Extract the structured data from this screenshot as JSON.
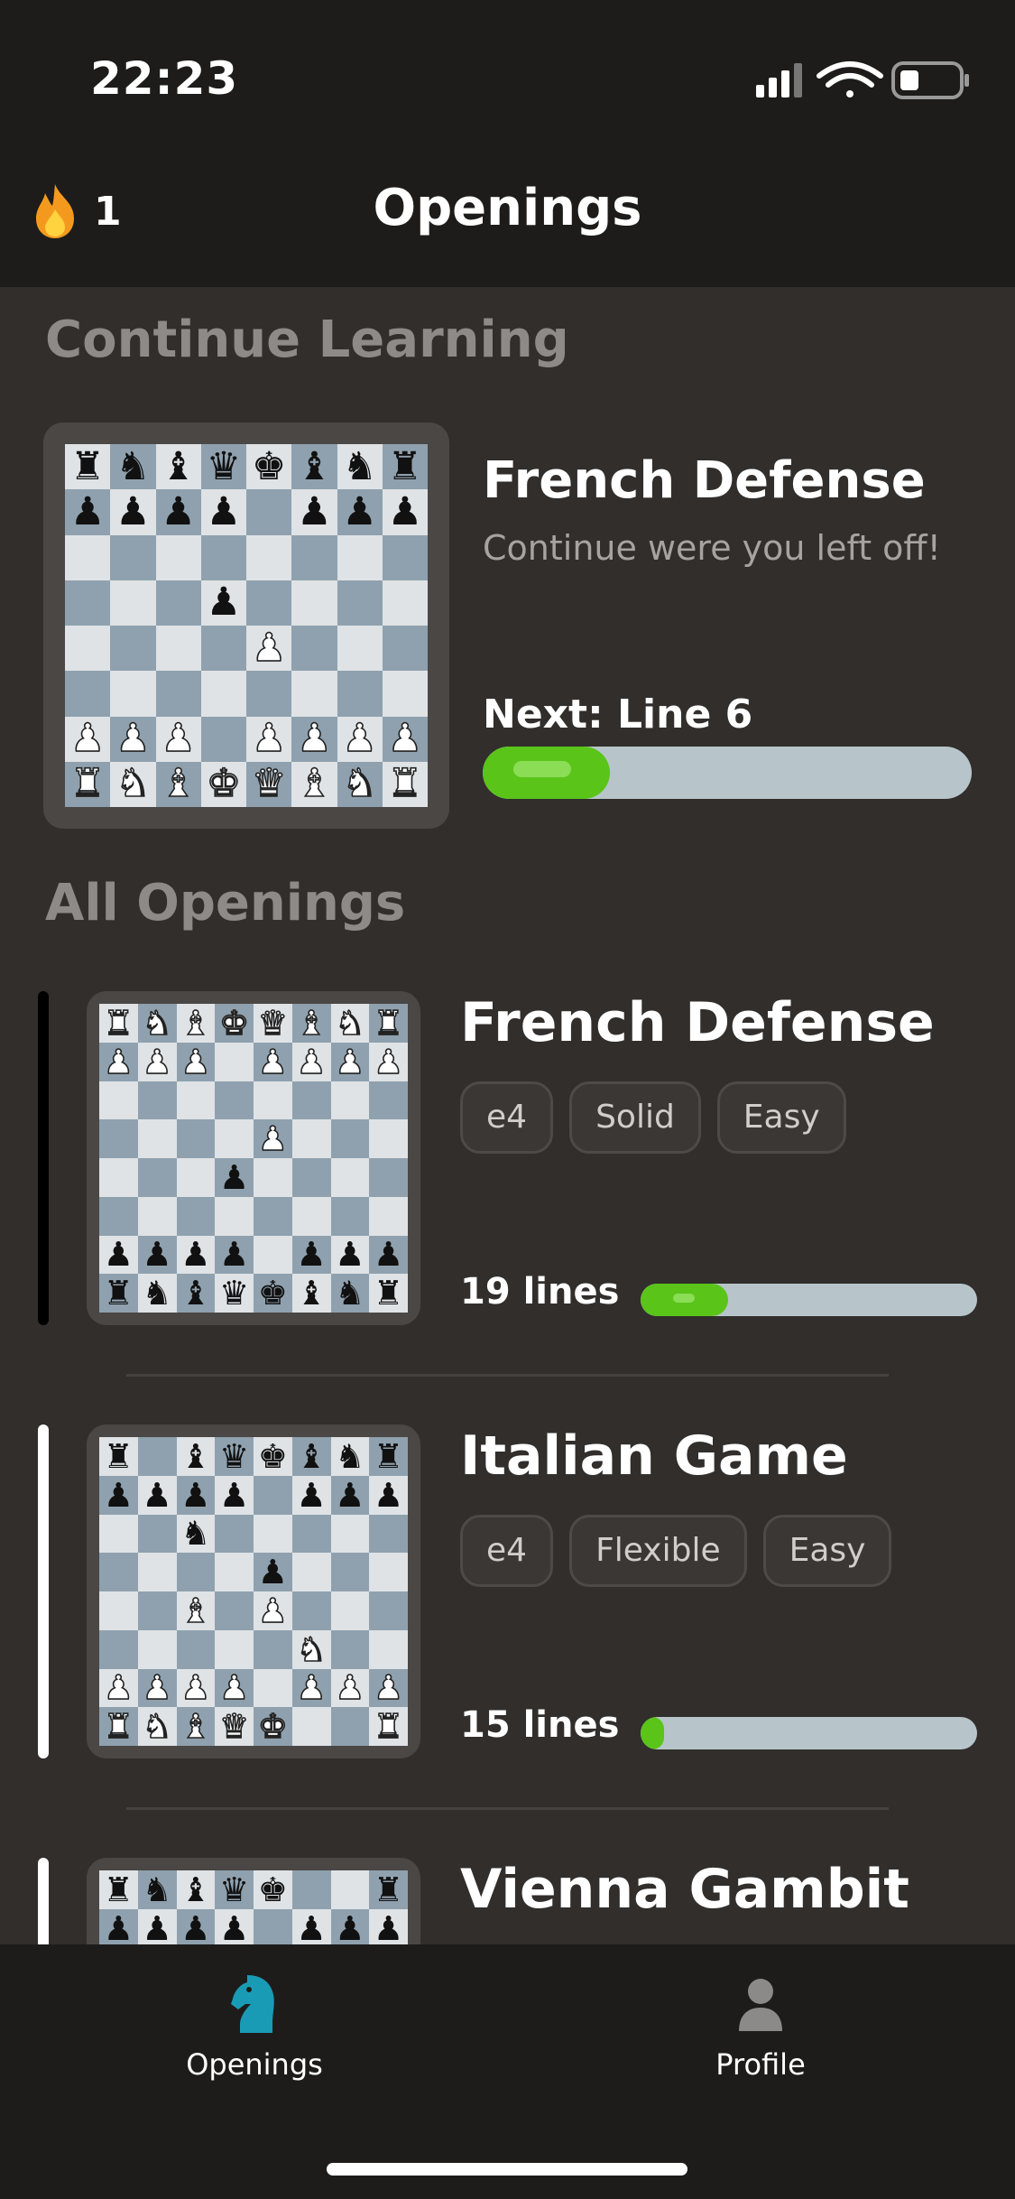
{
  "status": {
    "time": "22:23"
  },
  "header": {
    "title": "Openings",
    "streak_count": "1",
    "streak_icon": "fire-icon"
  },
  "continue": {
    "section_title": "Continue Learning",
    "title": "French Defense",
    "subtitle": "Continue were you left off!",
    "next_label": "Next: Line 6",
    "progress": 0.26,
    "board": [
      "rnbqkbnr",
      "pppp.ppp",
      "........",
      "...p....",
      "....P...",
      "........",
      "PPP.PPPP",
      "RNBKQBNR"
    ]
  },
  "all_openings": {
    "section_title": "All Openings",
    "items": [
      {
        "title": "French Defense",
        "tags": [
          "e4",
          "Solid",
          "Easy"
        ],
        "lines": "19 lines",
        "progress": 0.26,
        "selected": true,
        "board": [
          "RNBKQBNR",
          "PPP.PPPP",
          "........",
          "....P...",
          "...p....",
          "........",
          "pppp.ppp",
          "rnbqkbnr"
        ]
      },
      {
        "title": "Italian Game",
        "tags": [
          "e4",
          "Flexible",
          "Easy"
        ],
        "lines": "15 lines",
        "progress": 0.07,
        "selected": false,
        "board": [
          "r.bqkbnr",
          "pppp.ppp",
          "..n.....",
          "....p...",
          "..B.P...",
          ".....N..",
          "PPPP.PPP",
          "RNBQK..R"
        ]
      },
      {
        "title": "Vienna Gambit",
        "tags": [],
        "lines": "",
        "progress": 0,
        "selected": false,
        "board": [
          "rnbqk..r",
          "pppp.ppp",
          "........",
          "........",
          "........",
          "........",
          "........",
          "........"
        ]
      }
    ]
  },
  "tabs": [
    {
      "label": "Openings",
      "icon": "knight-icon",
      "active": true,
      "color": "#1a9bb5"
    },
    {
      "label": "Profile",
      "icon": "person-icon",
      "active": false,
      "color": "#8c8a88"
    }
  ],
  "colors": {
    "accent": "#5ac419",
    "track": "#b7c5ca",
    "board_light": "#dfe3e6",
    "board_dark": "#8fa1ae"
  }
}
